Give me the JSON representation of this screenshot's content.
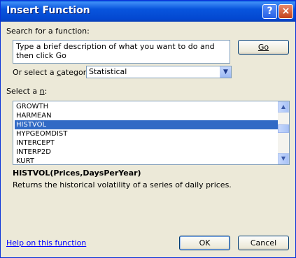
{
  "dialog": {
    "title": "Insert Function",
    "help_glyph": "?",
    "close_glyph": "×"
  },
  "search": {
    "label": "Search for a function:",
    "text": "Type a brief description of what you want to do and then click Go",
    "go_label": "Go"
  },
  "category": {
    "label_prefix": "Or select a ",
    "label_key": "c",
    "label_suffix": "ategory:",
    "selected": "Statistical"
  },
  "functions": {
    "label_prefix": "Select a ",
    "label_key": "n",
    "label_suffix": ":",
    "items": [
      "GROWTH",
      "HARMEAN",
      "HISTVOL",
      "HYPGEOMDIST",
      "INTERCEPT",
      "INTERP2D",
      "KURT"
    ],
    "selected_index": 2
  },
  "details": {
    "signature": "HISTVOL(Prices,DaysPerYear)",
    "description": "Returns the historical volatility of a series of daily prices."
  },
  "footer": {
    "help_link": "Help on this function",
    "ok_label": "OK",
    "cancel_label": "Cancel"
  },
  "icons": {
    "dropdown": "chevron-down-icon",
    "scroll_up": "scroll-up-arrow-icon",
    "scroll_down": "scroll-down-arrow-icon"
  }
}
